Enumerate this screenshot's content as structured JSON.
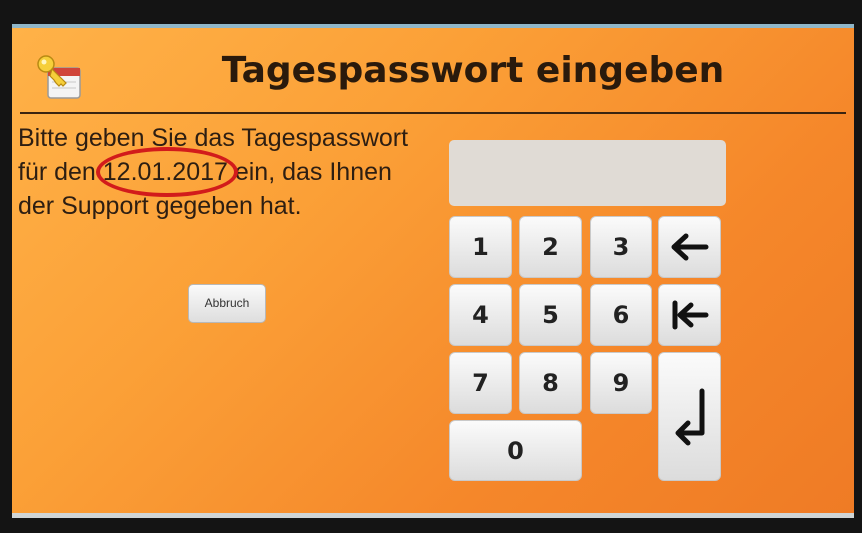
{
  "dialog": {
    "title": "Tagespasswort eingeben",
    "icon": "key-calendar-icon"
  },
  "message": {
    "part1": "Bitte geben Sie das Tagespasswort für den ",
    "date": "12.01.2017",
    "part2": " ein, das Ihnen der Support gegeben hat."
  },
  "buttons": {
    "cancel_label": "Abbruch"
  },
  "password_field": {
    "value": ""
  },
  "keypad": {
    "k1": "1",
    "k2": "2",
    "k3": "3",
    "k4": "4",
    "k5": "5",
    "k6": "6",
    "k7": "7",
    "k8": "8",
    "k9": "9",
    "k0": "0",
    "backspace_icon": "arrow-left-icon",
    "clear_icon": "arrow-left-to-bar-icon",
    "enter_icon": "enter-return-icon"
  },
  "colors": {
    "background": "#f89a34",
    "highlight_circle": "#d21b1b",
    "key_face": "#f0f0f0"
  }
}
